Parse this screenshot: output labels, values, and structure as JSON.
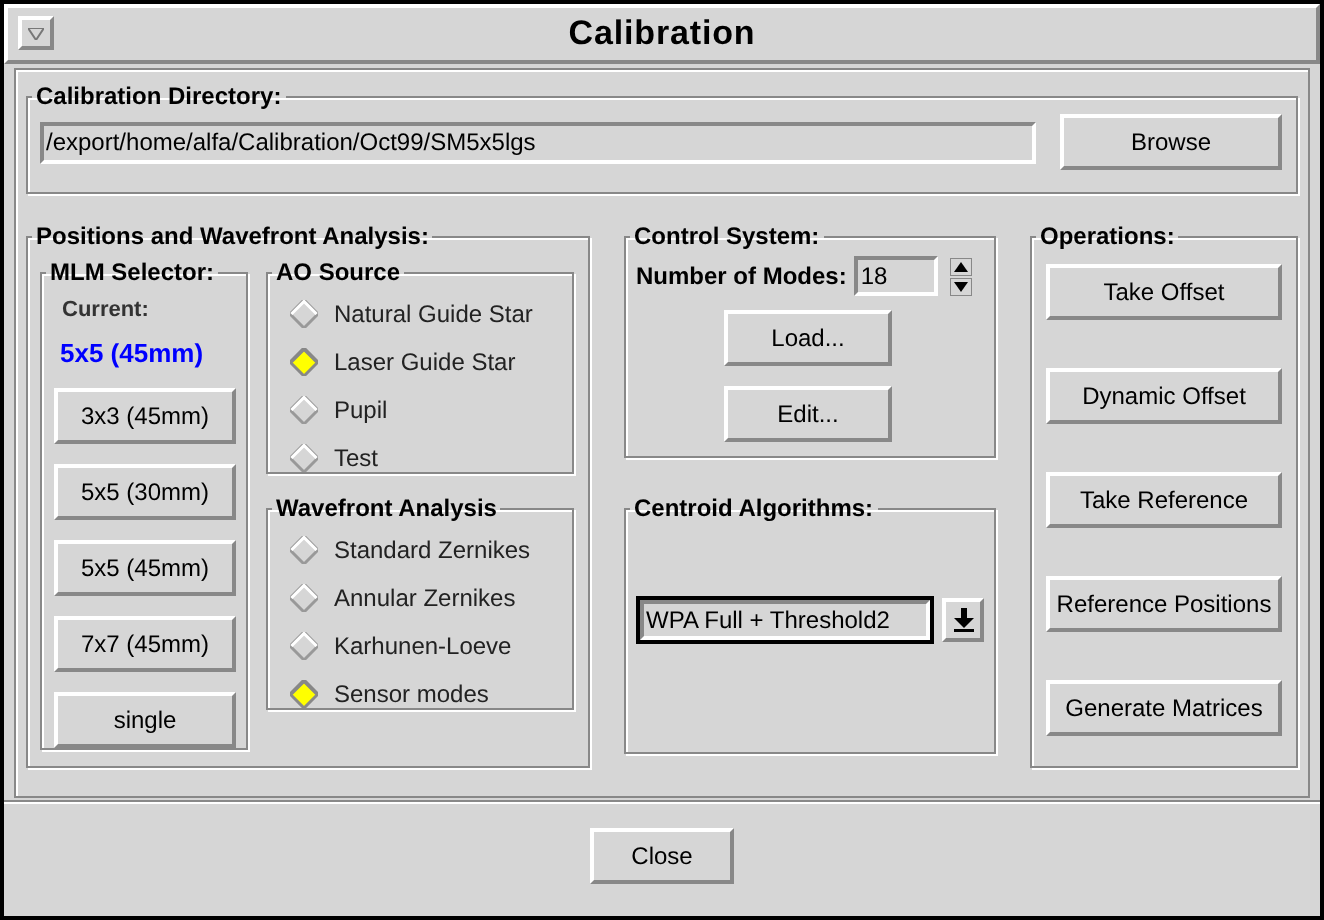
{
  "window": {
    "title": "Calibration"
  },
  "calibration_directory": {
    "title": "Calibration Directory:",
    "path": "/export/home/alfa/Calibration/Oct99/SM5x5lgs",
    "browse_button": "Browse"
  },
  "positions": {
    "title": "Positions and Wavefront Analysis:",
    "mlm_selector": {
      "title": "MLM Selector:",
      "current_label": "Current:",
      "current_value": "5x5 (45mm)",
      "buttons": [
        "3x3 (45mm)",
        "5x5 (30mm)",
        "5x5 (45mm)",
        "7x7 (45mm)",
        "single"
      ]
    },
    "ao_source": {
      "title": "AO Source",
      "options": [
        {
          "label": "Natural Guide Star",
          "selected": false
        },
        {
          "label": "Laser Guide Star",
          "selected": true
        },
        {
          "label": "Pupil",
          "selected": false
        },
        {
          "label": "Test",
          "selected": false
        }
      ]
    },
    "wavefront_analysis": {
      "title": "Wavefront Analysis",
      "options": [
        {
          "label": "Standard Zernikes",
          "selected": false
        },
        {
          "label": "Annular Zernikes",
          "selected": false
        },
        {
          "label": "Karhunen-Loeve",
          "selected": false
        },
        {
          "label": "Sensor modes",
          "selected": true
        }
      ]
    }
  },
  "control_system": {
    "title": "Control System:",
    "modes_label": "Number of Modes:",
    "modes_value": "18",
    "buttons": [
      "Load...",
      "Edit..."
    ]
  },
  "centroid_algorithms": {
    "title": "Centroid Algorithms:",
    "value": "WPA Full + Threshold2"
  },
  "operations": {
    "title": "Operations:",
    "buttons": [
      "Take Offset",
      "Dynamic Offset",
      "Take Reference",
      "Reference Positions",
      "Generate Matrices"
    ]
  },
  "footer": {
    "close_button": "Close"
  }
}
